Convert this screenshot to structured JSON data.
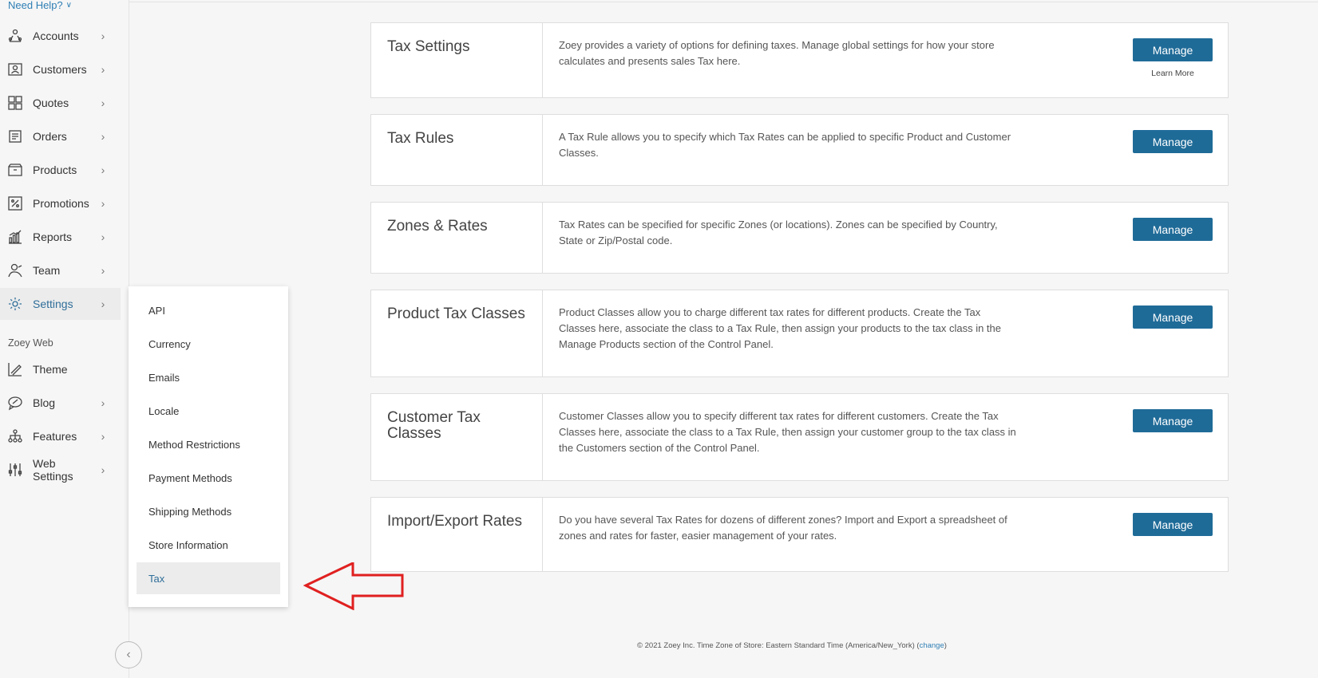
{
  "help": {
    "label": "Need Help?"
  },
  "sidebar": {
    "items": [
      {
        "label": "Accounts",
        "icon": "accounts-icon"
      },
      {
        "label": "Customers",
        "icon": "customers-icon"
      },
      {
        "label": "Quotes",
        "icon": "quotes-icon"
      },
      {
        "label": "Orders",
        "icon": "orders-icon"
      },
      {
        "label": "Products",
        "icon": "products-icon"
      },
      {
        "label": "Promotions",
        "icon": "promotions-icon"
      },
      {
        "label": "Reports",
        "icon": "reports-icon"
      },
      {
        "label": "Team",
        "icon": "team-icon"
      },
      {
        "label": "Settings",
        "icon": "settings-icon"
      }
    ],
    "web_section_label": "Zoey Web",
    "web_items": [
      {
        "label": "Theme",
        "icon": "theme-icon"
      },
      {
        "label": "Blog",
        "icon": "blog-icon"
      },
      {
        "label": "Features",
        "icon": "features-icon"
      },
      {
        "label": "Web Settings",
        "icon": "web-settings-icon"
      }
    ]
  },
  "settings_menu": {
    "items": [
      "API",
      "Currency",
      "Emails",
      "Locale",
      "Method Restrictions",
      "Payment Methods",
      "Shipping Methods",
      "Store Information",
      "Tax"
    ],
    "active": "Tax"
  },
  "cards": [
    {
      "title": "Tax Settings",
      "description": "Zoey provides a variety of options for defining taxes. Manage global settings for how your store calculates and presents sales Tax here.",
      "button": "Manage",
      "learn_more": "Learn More"
    },
    {
      "title": "Tax Rules",
      "description": "A Tax Rule allows you to specify which Tax Rates can be applied to specific Product and Customer Classes.",
      "button": "Manage"
    },
    {
      "title": "Zones & Rates",
      "description": "Tax Rates can be specified for specific Zones (or locations). Zones can be specified by Country, State or Zip/Postal code.",
      "button": "Manage"
    },
    {
      "title": "Product Tax Classes",
      "description": "Product Classes allow you to charge different tax rates for different products. Create the Tax Classes here, associate the class to a Tax Rule, then assign your products to the tax class in the Manage Products section of the Control Panel.",
      "button": "Manage"
    },
    {
      "title": "Customer Tax Classes",
      "description": "Customer Classes allow you to specify different tax rates for different customers. Create the Tax Classes here, associate the class to a Tax Rule, then assign your customer group to the tax class in the Customers section of the Control Panel.",
      "button": "Manage"
    },
    {
      "title": "Import/Export Rates",
      "description": "Do you have several Tax Rates for dozens of different zones? Import and Export a spreadsheet of zones and rates for faster, easier management of your rates.",
      "button": "Manage"
    }
  ],
  "footer": {
    "text": "© 2021 Zoey Inc. Time Zone of Store: Eastern Standard Time (America/New_York) (",
    "link": "change",
    "close": ")"
  },
  "colors": {
    "accent": "#1f6b98",
    "link": "#2f7fb5",
    "annotation": "#e02020"
  }
}
